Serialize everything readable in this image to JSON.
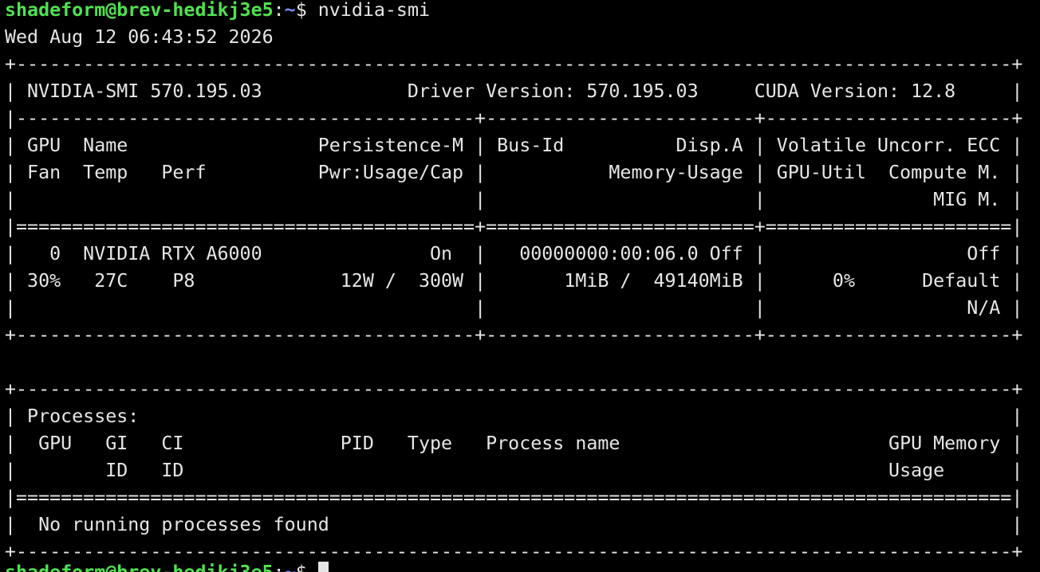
{
  "colors": {
    "background": "#000000",
    "text": "#e6e6e6",
    "prompt_user": "#4fe34f",
    "prompt_path": "#7a8cff"
  },
  "prompt": {
    "user_host": "shadeform@brev-hedikj3e5",
    "separator": ":",
    "path": "~",
    "symbol": "$ ",
    "command": "nvidia-smi"
  },
  "timestamp": "Wed Aug 12 06:43:52 2026",
  "lines": [
    "+-----------------------------------------------------------------------------------------+",
    "| NVIDIA-SMI 570.195.03             Driver Version: 570.195.03     CUDA Version: 12.8     |",
    "|-----------------------------------------+------------------------+----------------------+",
    "| GPU  Name                 Persistence-M | Bus-Id          Disp.A | Volatile Uncorr. ECC |",
    "| Fan  Temp   Perf          Pwr:Usage/Cap |           Memory-Usage | GPU-Util  Compute M. |",
    "|                                         |                        |               MIG M. |",
    "|=========================================+========================+======================|",
    "|   0  NVIDIA RTX A6000               On  |   00000000:00:06.0 Off |                  Off |",
    "| 30%   27C    P8             12W /  300W |       1MiB /  49140MiB |      0%      Default |",
    "|                                         |                        |                  N/A |",
    "+-----------------------------------------+------------------------+----------------------+",
    "",
    "+-----------------------------------------------------------------------------------------+",
    "| Processes:                                                                              |",
    "|  GPU   GI   CI              PID   Type   Process name                        GPU Memory |",
    "|        ID   ID                                                               Usage      |",
    "|=========================================================================================|",
    "|  No running processes found                                                             |",
    "+-----------------------------------------------------------------------------------------+"
  ]
}
